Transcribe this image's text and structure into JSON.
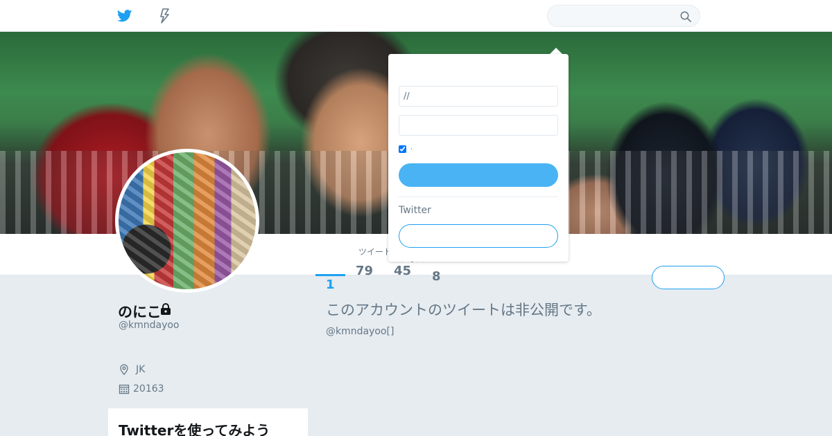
{
  "nav": {
    "logo_icon": "twitter-bird-icon",
    "moments_icon": "lightning-icon",
    "search": {
      "placeholder": "",
      "icon": "search-icon"
    },
    "brand_color": "#1da1f2"
  },
  "profile": {
    "display_name": "のにこ",
    "handle": "@kmndayoo",
    "protected_icon": "lock-icon",
    "location": "JK",
    "location_icon": "location-pin-icon",
    "joined": "20163",
    "joined_icon": "calendar-icon"
  },
  "stats": [
    {
      "label": "ツイート",
      "value": "1",
      "active": true
    },
    {
      "label": "",
      "value": "79",
      "active": false
    },
    {
      "label": "フォロ",
      "value": "45",
      "active": false
    },
    {
      "label": "",
      "value": "8",
      "active": false
    }
  ],
  "follow_button": {
    "label": ""
  },
  "protected_notice": {
    "title": "このアカウントのツイートは非公開です。",
    "subtitle": "@kmndayoo[]"
  },
  "join_card": {
    "title": "Twitterを使ってみよう"
  },
  "login_dropdown": {
    "username_value": "//",
    "password_value": "",
    "remember_label": "·",
    "remember_checked": true,
    "login_label": "",
    "signup_prompt": "Twitter",
    "signup_label": ""
  }
}
